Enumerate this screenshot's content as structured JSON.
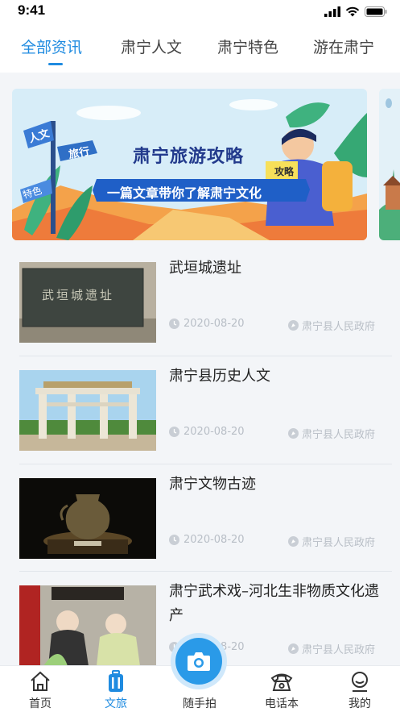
{
  "status": {
    "time": "9:41"
  },
  "tabs": [
    {
      "label": "全部资讯",
      "active": true
    },
    {
      "label": "肃宁人文",
      "active": false
    },
    {
      "label": "肃宁特色",
      "active": false
    },
    {
      "label": "游在肃宁",
      "active": false
    }
  ],
  "banner": {
    "title": "肃宁旅游攻略",
    "subtitle": "一篇文章带你了解肃宁文化",
    "sign_top": "人文",
    "sign_mid": "旅行",
    "sign_low": "特色",
    "book_label": "攻略"
  },
  "news": [
    {
      "title": "武垣城遗址",
      "date": "2020-08-20",
      "source": "肃宁县人民政府",
      "stone_text": "武垣城遗址"
    },
    {
      "title": "肃宁县历史人文",
      "date": "2020-08-20",
      "source": "肃宁县人民政府"
    },
    {
      "title": "肃宁文物古迹",
      "date": "2020-08-20",
      "source": "肃宁县人民政府"
    },
    {
      "title": "肃宁武术戏–河北生非物质文化遗产",
      "date": "2020-08-20",
      "source": "肃宁县人民政府"
    }
  ],
  "bottom_nav": [
    {
      "label": "首页",
      "icon": "home-icon",
      "active": false
    },
    {
      "label": "文旅",
      "icon": "luggage-icon",
      "active": true
    },
    {
      "label": "随手拍",
      "icon": "camera-icon",
      "active": false
    },
    {
      "label": "电话本",
      "icon": "phone-icon",
      "active": false
    },
    {
      "label": "我的",
      "icon": "user-icon",
      "active": false
    }
  ],
  "colors": {
    "accent": "#1f8be0",
    "meta": "#b8bec6"
  }
}
